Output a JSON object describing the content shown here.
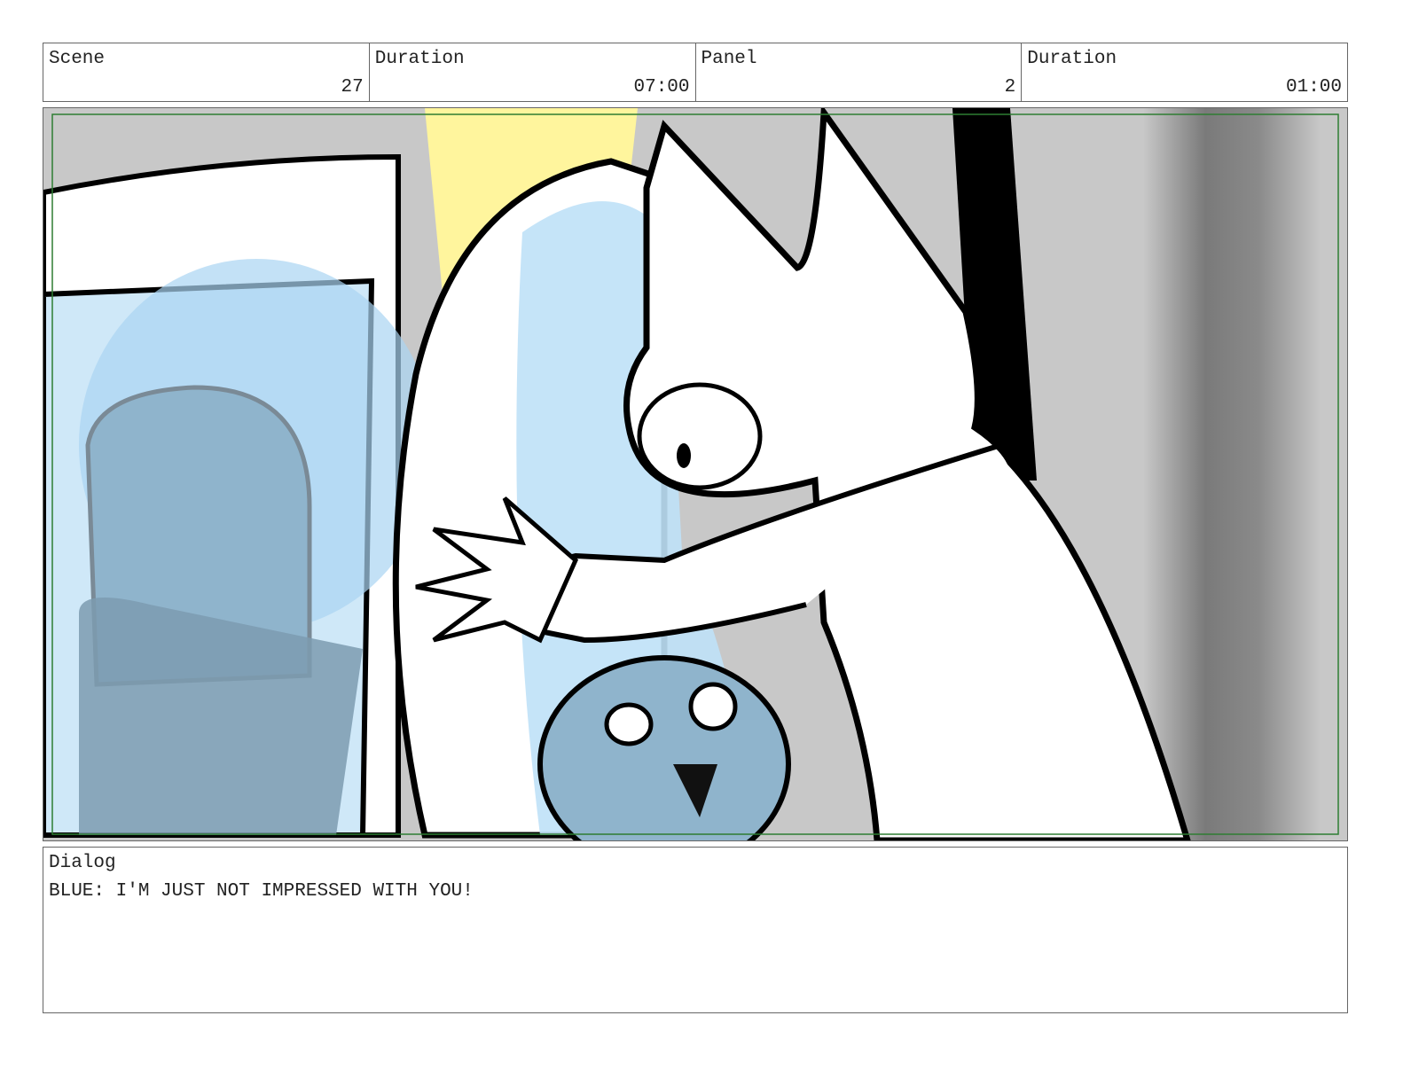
{
  "header": {
    "scene_label": "Scene",
    "scene_value": "27",
    "scene_duration_label": "Duration",
    "scene_duration_value": "07:00",
    "panel_label": "Panel",
    "panel_value": "2",
    "panel_duration_label": "Duration",
    "panel_duration_value": "01:00"
  },
  "dialog": {
    "label": "Dialog",
    "text": "BLUE: I'M JUST NOT IMPRESSED WITH YOU!"
  },
  "colors": {
    "safe_area": "#2e7d32",
    "blue_tint": "#a9d4f2",
    "yellow": "#fff59d",
    "grey_wall": "#c8c8c8"
  }
}
